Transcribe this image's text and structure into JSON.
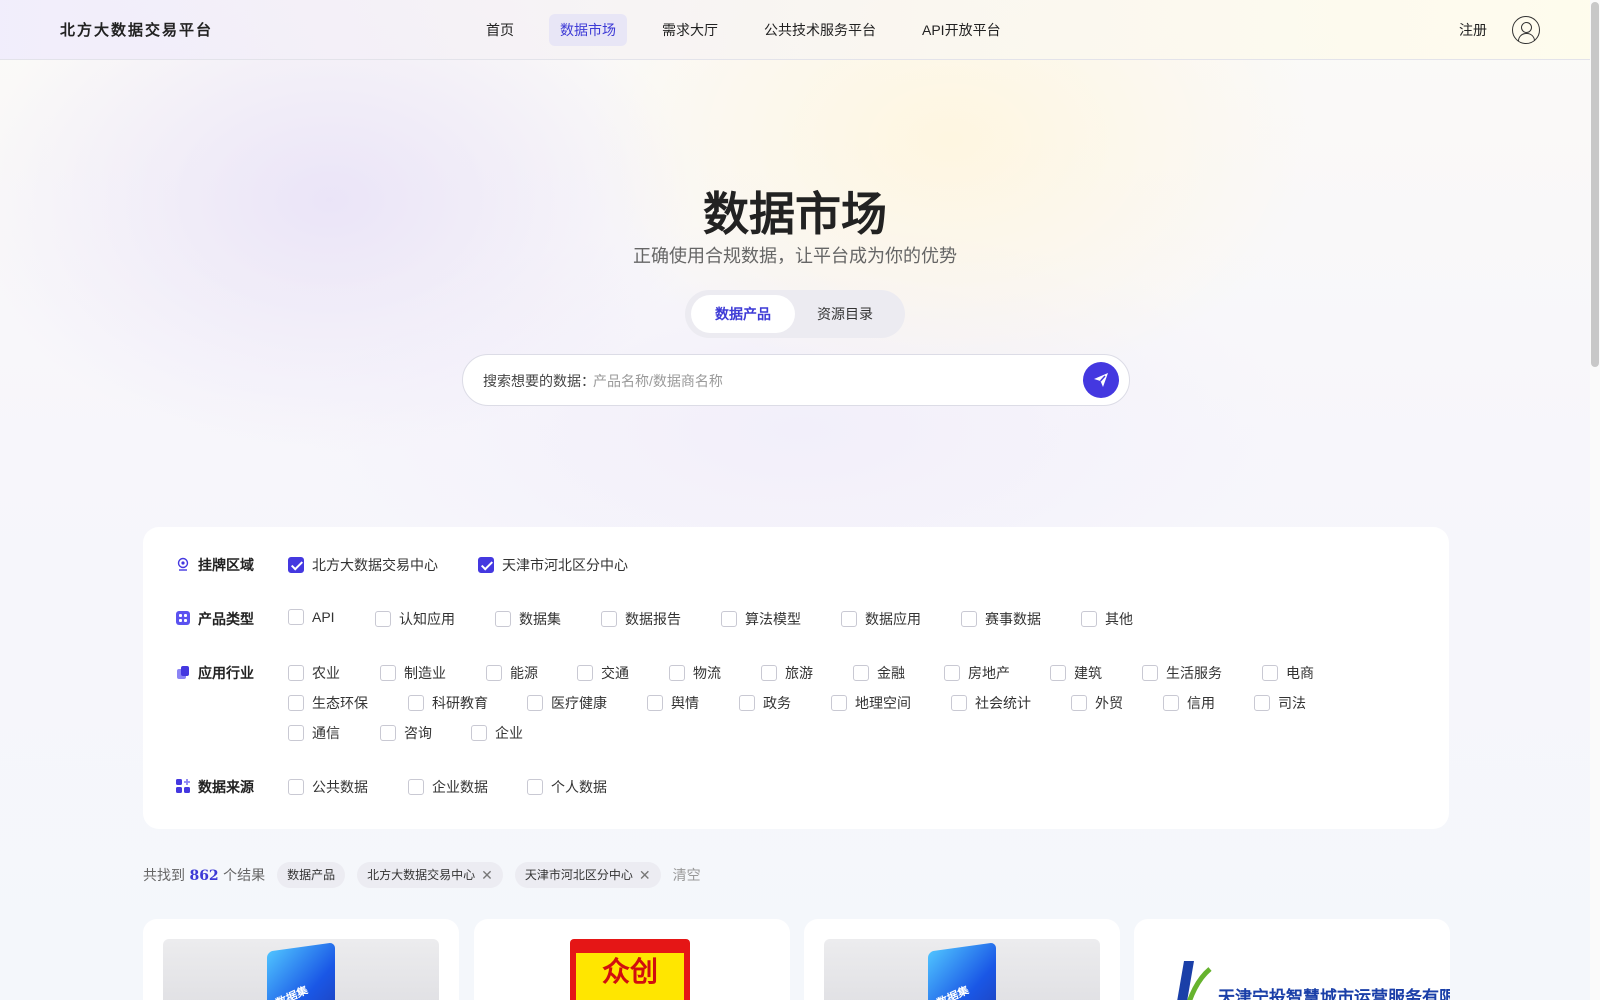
{
  "header": {
    "logo": "北方大数据交易平台",
    "nav": [
      "首页",
      "数据市场",
      "需求大厅",
      "公共技术服务平台",
      "API开放平台"
    ],
    "active_nav": "数据市场",
    "register": "注册"
  },
  "hero": {
    "title": "数据市场",
    "subtitle": "正确使用合规数据，让平台成为你的优势",
    "tabs": [
      "数据产品",
      "资源目录"
    ],
    "active_tab": "数据产品"
  },
  "search": {
    "label": "搜索想要的数据：",
    "placeholder": "产品名称/数据商名称"
  },
  "filters": {
    "region": {
      "label": "挂牌区域",
      "options": [
        "北方大数据交易中心",
        "天津市河北区分中心"
      ],
      "checked": [
        true,
        true
      ]
    },
    "product_type": {
      "label": "产品类型",
      "options": [
        "API",
        "认知应用",
        "数据集",
        "数据报告",
        "算法模型",
        "数据应用",
        "赛事数据",
        "其他"
      ]
    },
    "industry": {
      "label": "应用行业",
      "rows": [
        [
          "农业",
          "制造业",
          "能源",
          "交通",
          "物流",
          "旅游",
          "金融",
          "房地产",
          "建筑",
          "生活服务",
          "电商"
        ],
        [
          "生态环保",
          "科研教育",
          "医疗健康",
          "舆情",
          "政务",
          "地理空间",
          "社会统计",
          "外贸",
          "信用",
          "司法"
        ],
        [
          "通信",
          "咨询",
          "企业"
        ]
      ]
    },
    "source": {
      "label": "数据来源",
      "options": [
        "公共数据",
        "企业数据",
        "个人数据"
      ]
    }
  },
  "results": {
    "prefix": "共找到",
    "count": "862",
    "suffix": "个结果",
    "chips": [
      "数据产品",
      "北方大数据交易中心",
      "天津市河北区分中心"
    ],
    "clear": "清空"
  },
  "cards": [
    {
      "type": "cube",
      "thumb_text": "数据集"
    },
    {
      "type": "poster",
      "thumb_text": "众创"
    },
    {
      "type": "cube",
      "thumb_text": "数据集"
    },
    {
      "type": "company",
      "thumb_text": "天津宁投智慧城市运营服务有限公司"
    }
  ],
  "colors": {
    "accent": "#4438e0",
    "active_text": "#3d3ad6"
  }
}
